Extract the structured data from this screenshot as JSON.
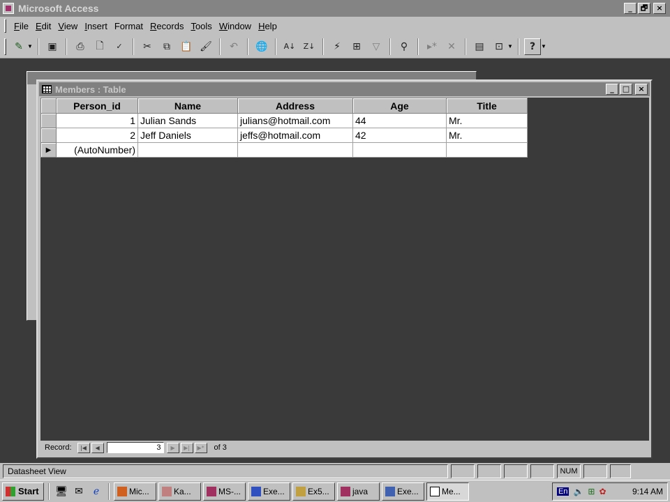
{
  "app": {
    "title": "Microsoft Access",
    "controls": [
      "_",
      "🗗",
      "×"
    ]
  },
  "menu": [
    {
      "underline": "F",
      "rest": "ile"
    },
    {
      "underline": "E",
      "rest": "dit"
    },
    {
      "underline": "V",
      "rest": "iew"
    },
    {
      "underline": "I",
      "rest": "nsert"
    },
    {
      "underline": "",
      "rest": "Format",
      "u_mid": "o"
    },
    {
      "underline": "R",
      "rest": "ecords"
    },
    {
      "underline": "T",
      "rest": "ools"
    },
    {
      "underline": "W",
      "rest": "indow"
    },
    {
      "underline": "H",
      "rest": "elp"
    }
  ],
  "window": {
    "title": "Members : Table",
    "controls": [
      "_",
      "□",
      "×"
    ]
  },
  "table": {
    "columns": [
      "Person_id",
      "Name",
      "Address",
      "Age",
      "Title"
    ],
    "rows": [
      {
        "Person_id": "1",
        "Name": "Julian Sands",
        "Address": "julians@hotmail.com",
        "Age": "44",
        "Title": "Mr."
      },
      {
        "Person_id": "2",
        "Name": "Jeff Daniels",
        "Address": "jeffs@hotmail.com",
        "Age": "42",
        "Title": "Mr."
      }
    ],
    "new_row_placeholder": "(AutoNumber)"
  },
  "navigator": {
    "label": "Record:",
    "current": "3",
    "of_text": "of 3"
  },
  "status": {
    "text": "Datasheet View",
    "num": "NUM"
  },
  "taskbar": {
    "start_label": "Start",
    "tasks": [
      "Mic...",
      "Ka...",
      "MS-...",
      "Exe...",
      "Ex5...",
      "java",
      "Exe...",
      "Me..."
    ],
    "language": "En",
    "clock": "9:14 AM"
  },
  "colors": {
    "title_inactive": "#848484",
    "face": "#c0c0c0",
    "workspace": "#3a3a3a"
  }
}
